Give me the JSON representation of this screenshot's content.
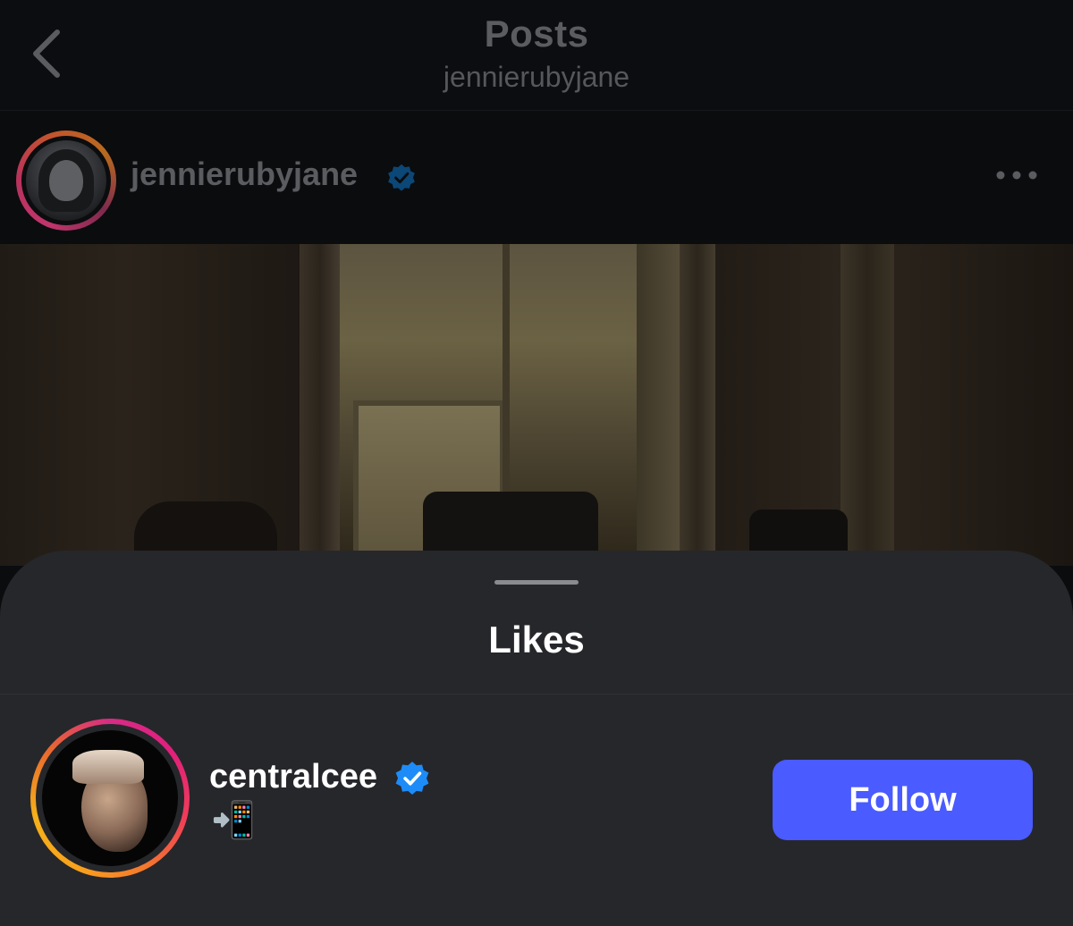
{
  "nav": {
    "title": "Posts",
    "subtitle": "jennierubyjane",
    "back_icon": "chevron-left-icon"
  },
  "post": {
    "username": "jennierubyjane",
    "verified": true,
    "more_icon": "more-horizontal-icon"
  },
  "likes_sheet": {
    "title": "Likes",
    "users": [
      {
        "username": "centralcee",
        "verified": true,
        "bio": "📲",
        "button_label": "Follow"
      }
    ]
  },
  "colors": {
    "follow_button": "#4a5bff",
    "verified_badge": "#1d8cf8",
    "sheet_background": "#26272b"
  }
}
